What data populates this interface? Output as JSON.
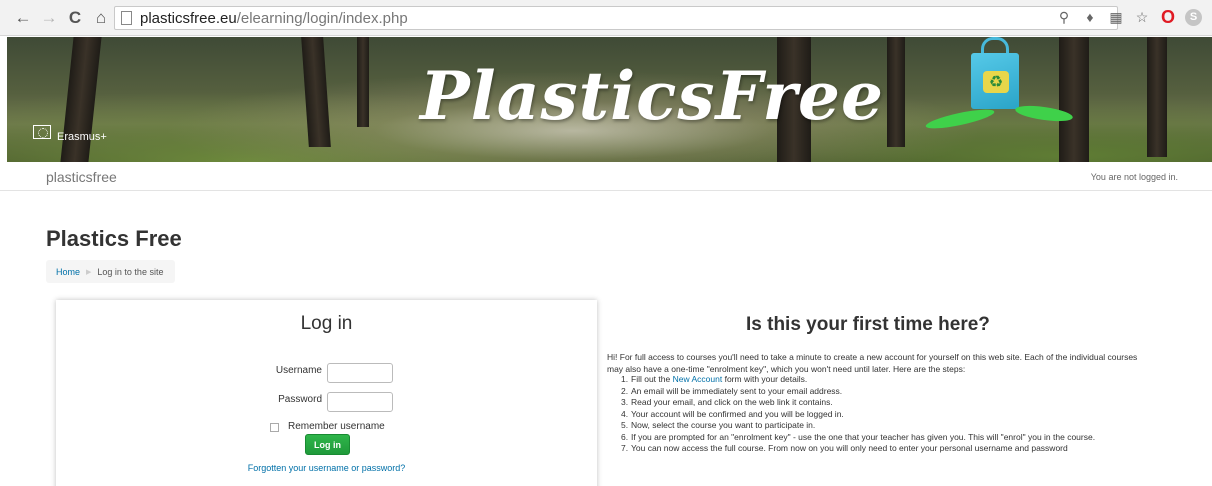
{
  "browser": {
    "url_host": "plasticsfree.eu",
    "url_path": "/elearning/login/index.php",
    "icons": [
      "back-icon",
      "forward-icon",
      "reload-icon",
      "home-icon",
      "page-icon",
      "zoom-icon",
      "extension-icon",
      "translate-icon",
      "star-icon",
      "opera-icon",
      "skype-icon"
    ]
  },
  "banner": {
    "title": "PlasticsFree",
    "erasmus_label": "Erasmus+"
  },
  "navbar": {
    "brand": "plasticsfree",
    "login_info": "You are not logged in."
  },
  "page": {
    "title": "Plastics Free",
    "breadcrumb": [
      "Home",
      "Log in to the site"
    ]
  },
  "login": {
    "heading": "Log in",
    "username_label": "Username",
    "username_value": "",
    "password_label": "Password",
    "password_value": "",
    "remember_label": "Remember username",
    "remember_checked": false,
    "submit_label": "Log in",
    "forgot_link": "Forgotten your username or password?",
    "submit_color": "#24a641"
  },
  "first_time": {
    "heading": "Is this your first time here?",
    "intro": "Hi! For full access to courses you'll need to take a minute to create a new account for yourself on this web site. Each of the individual courses may also have a one-time \"enrolment key\", which you won't need until later. Here are the steps:",
    "step1_pre": "Fill out the",
    "step1_link": "New Account",
    "step1_post": "form with your details.",
    "steps": [
      "An email will be immediately sent to your email address.",
      "Read your email, and click on the web link it contains.",
      "Your account will be confirmed and you will be logged in.",
      "Now, select the course you want to participate in.",
      "If you are prompted for an \"enrolment key\" - use the one that your teacher has given you. This will \"enrol\" you in the course.",
      "You can now access the full course. From now on you will only need to enter your personal username and password"
    ]
  },
  "colors": {
    "link": "#0070a8",
    "button_green": "#24a641"
  }
}
